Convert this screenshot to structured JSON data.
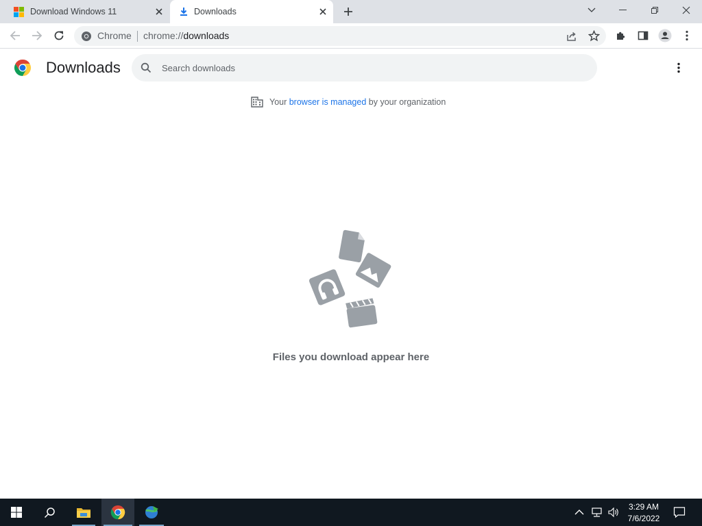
{
  "browser": {
    "tabs": [
      {
        "title": "Download Windows 11",
        "icon": "windows-logo-icon",
        "active": false
      },
      {
        "title": "Downloads",
        "icon": "download-arrow-icon",
        "active": true
      }
    ],
    "window_controls": [
      "chevron-down-icon",
      "minimize-icon",
      "restore-icon",
      "close-icon"
    ]
  },
  "toolbar": {
    "site_label": "Chrome",
    "url_scheme": "chrome://",
    "url_host": "downloads"
  },
  "page": {
    "title": "Downloads",
    "search_placeholder": "Search downloads",
    "managed_prefix": "Your ",
    "managed_link": "browser is managed",
    "managed_suffix": " by your organization",
    "empty_message": "Files you download appear here"
  },
  "taskbar": {
    "time": "3:29 AM",
    "date": "7/6/2022",
    "apps": [
      "start-icon",
      "search-icon",
      "file-explorer-icon",
      "chrome-icon",
      "internet-download-manager-icon"
    ]
  },
  "colors": {
    "link": "#1a73e8",
    "tabstrip": "#dee1e6",
    "taskbar": "#101820",
    "illustration": "#9aa0a6"
  }
}
